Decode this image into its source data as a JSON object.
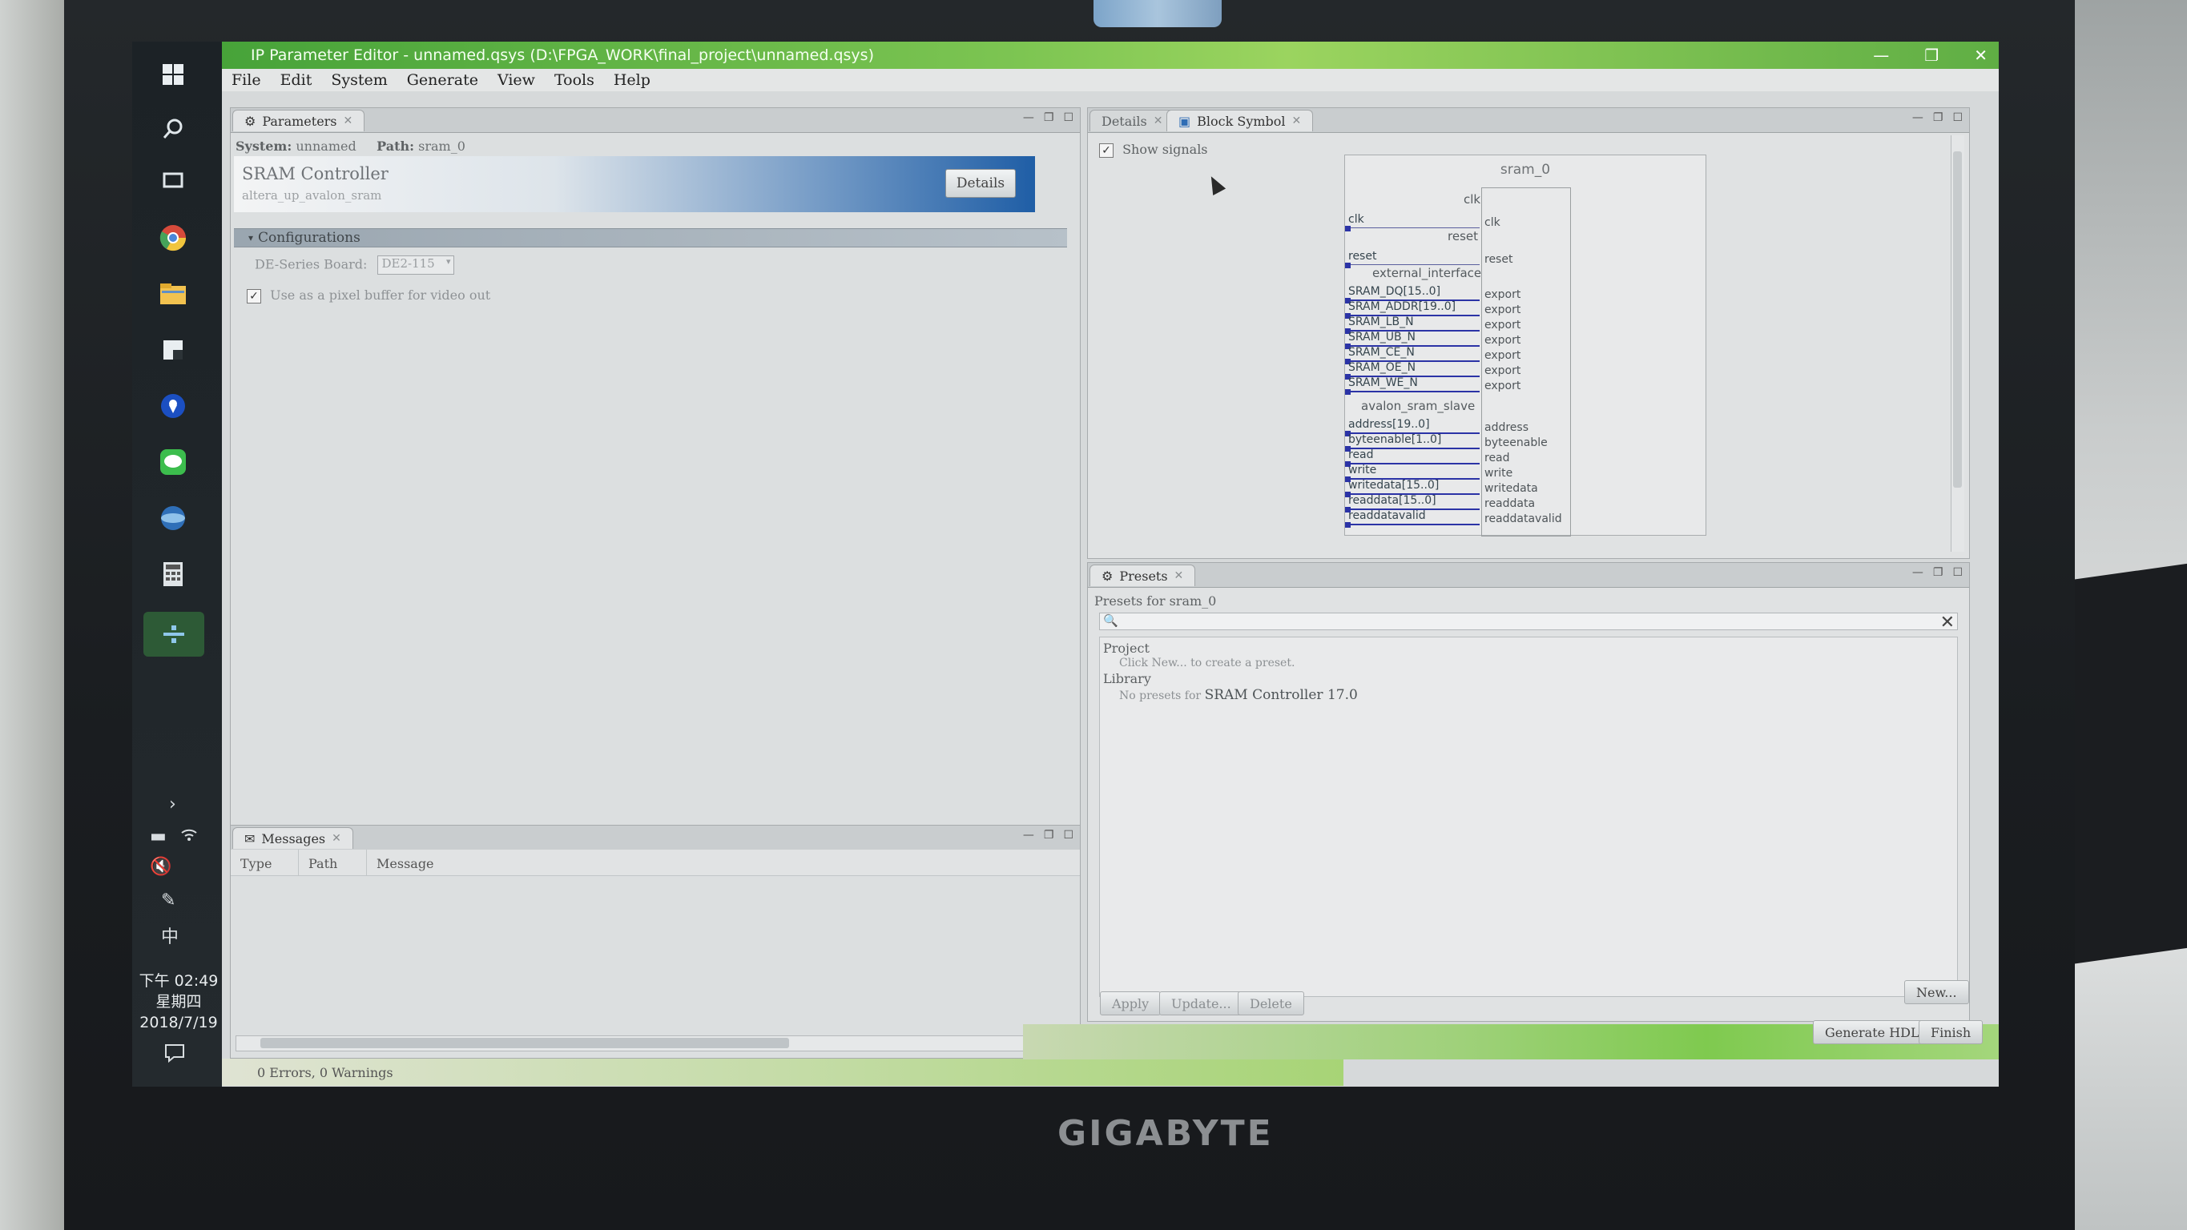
{
  "brand": "GIGABYTE",
  "window": {
    "title": "IP Parameter Editor - unnamed.qsys (D:\\FPGA_WORK\\final_project\\unnamed.qsys)",
    "controls": {
      "minimize": "—",
      "restore": "❐",
      "close": "✕"
    }
  },
  "menu": [
    "File",
    "Edit",
    "System",
    "Generate",
    "View",
    "Tools",
    "Help"
  ],
  "taskbar": {
    "icons": [
      "windows-icon",
      "search-icon",
      "task-view-icon",
      "chrome-icon",
      "file-explorer-icon",
      "notes-icon",
      "maps-icon",
      "line-chat-icon",
      "network-icon",
      "calculator-icon",
      "quartus-icon"
    ],
    "tray": {
      "expand": "›",
      "battery": "▬",
      "volume": "🔇",
      "pen": "✎",
      "ime": "中"
    },
    "clock": {
      "time": "下午 02:49",
      "weekday": "星期四",
      "date": "2018/7/19"
    }
  },
  "parameters": {
    "tab_label": "Parameters",
    "system_label": "System:",
    "system_value": "unnamed",
    "path_label": "Path:",
    "path_value": "sram_0",
    "component_title": "SRAM Controller",
    "component_subtitle": "altera_up_avalon_sram",
    "details_button": "Details",
    "section_title": "Configurations",
    "board_label": "DE-Series Board:",
    "board_value": "DE2-115",
    "pixel_buffer_label": "Use as a pixel buffer for video out",
    "pixel_buffer_checked": true
  },
  "messages": {
    "tab_label": "Messages",
    "columns": [
      "Type",
      "Path",
      "Message"
    ],
    "status": "0 Errors, 0 Warnings"
  },
  "block_symbol": {
    "tabs": [
      "Details",
      "Block Symbol"
    ],
    "show_signals_label": "Show signals",
    "show_signals_checked": true,
    "instance_name": "sram_0",
    "interfaces": {
      "clk": "clk",
      "reset": "reset",
      "external": "external_interface",
      "avalon": "avalon_sram_slave"
    },
    "clk_signal": "clk",
    "clk_port": "clk",
    "reset_signal": "reset",
    "reset_port": "reset",
    "external_signals": [
      "SRAM_DQ[15..0]",
      "SRAM_ADDR[19..0]",
      "SRAM_LB_N",
      "SRAM_UB_N",
      "SRAM_CE_N",
      "SRAM_OE_N",
      "SRAM_WE_N"
    ],
    "external_ports": [
      "export",
      "export",
      "export",
      "export",
      "export",
      "export",
      "export"
    ],
    "avalon_signals": [
      "address[19..0]",
      "byteenable[1..0]",
      "read",
      "write",
      "writedata[15..0]",
      "readdata[15..0]",
      "readdatavalid"
    ],
    "avalon_ports": [
      "address",
      "byteenable",
      "read",
      "write",
      "writedata",
      "readdata",
      "readdatavalid"
    ]
  },
  "presets": {
    "tab_label": "Presets",
    "header": "Presets for sram_0",
    "search_icon": "🔍",
    "clear_icon": "✕",
    "project_label": "Project",
    "project_hint": "Click New... to create a preset.",
    "library_label": "Library",
    "library_hint_prefix": "No presets for",
    "library_hint_name": "SRAM Controller 17.0",
    "buttons": {
      "apply": "Apply",
      "update": "Update...",
      "delete": "Delete",
      "new": "New..."
    }
  },
  "footer_buttons": {
    "generate": "Generate HDL...",
    "finish": "Finish"
  }
}
